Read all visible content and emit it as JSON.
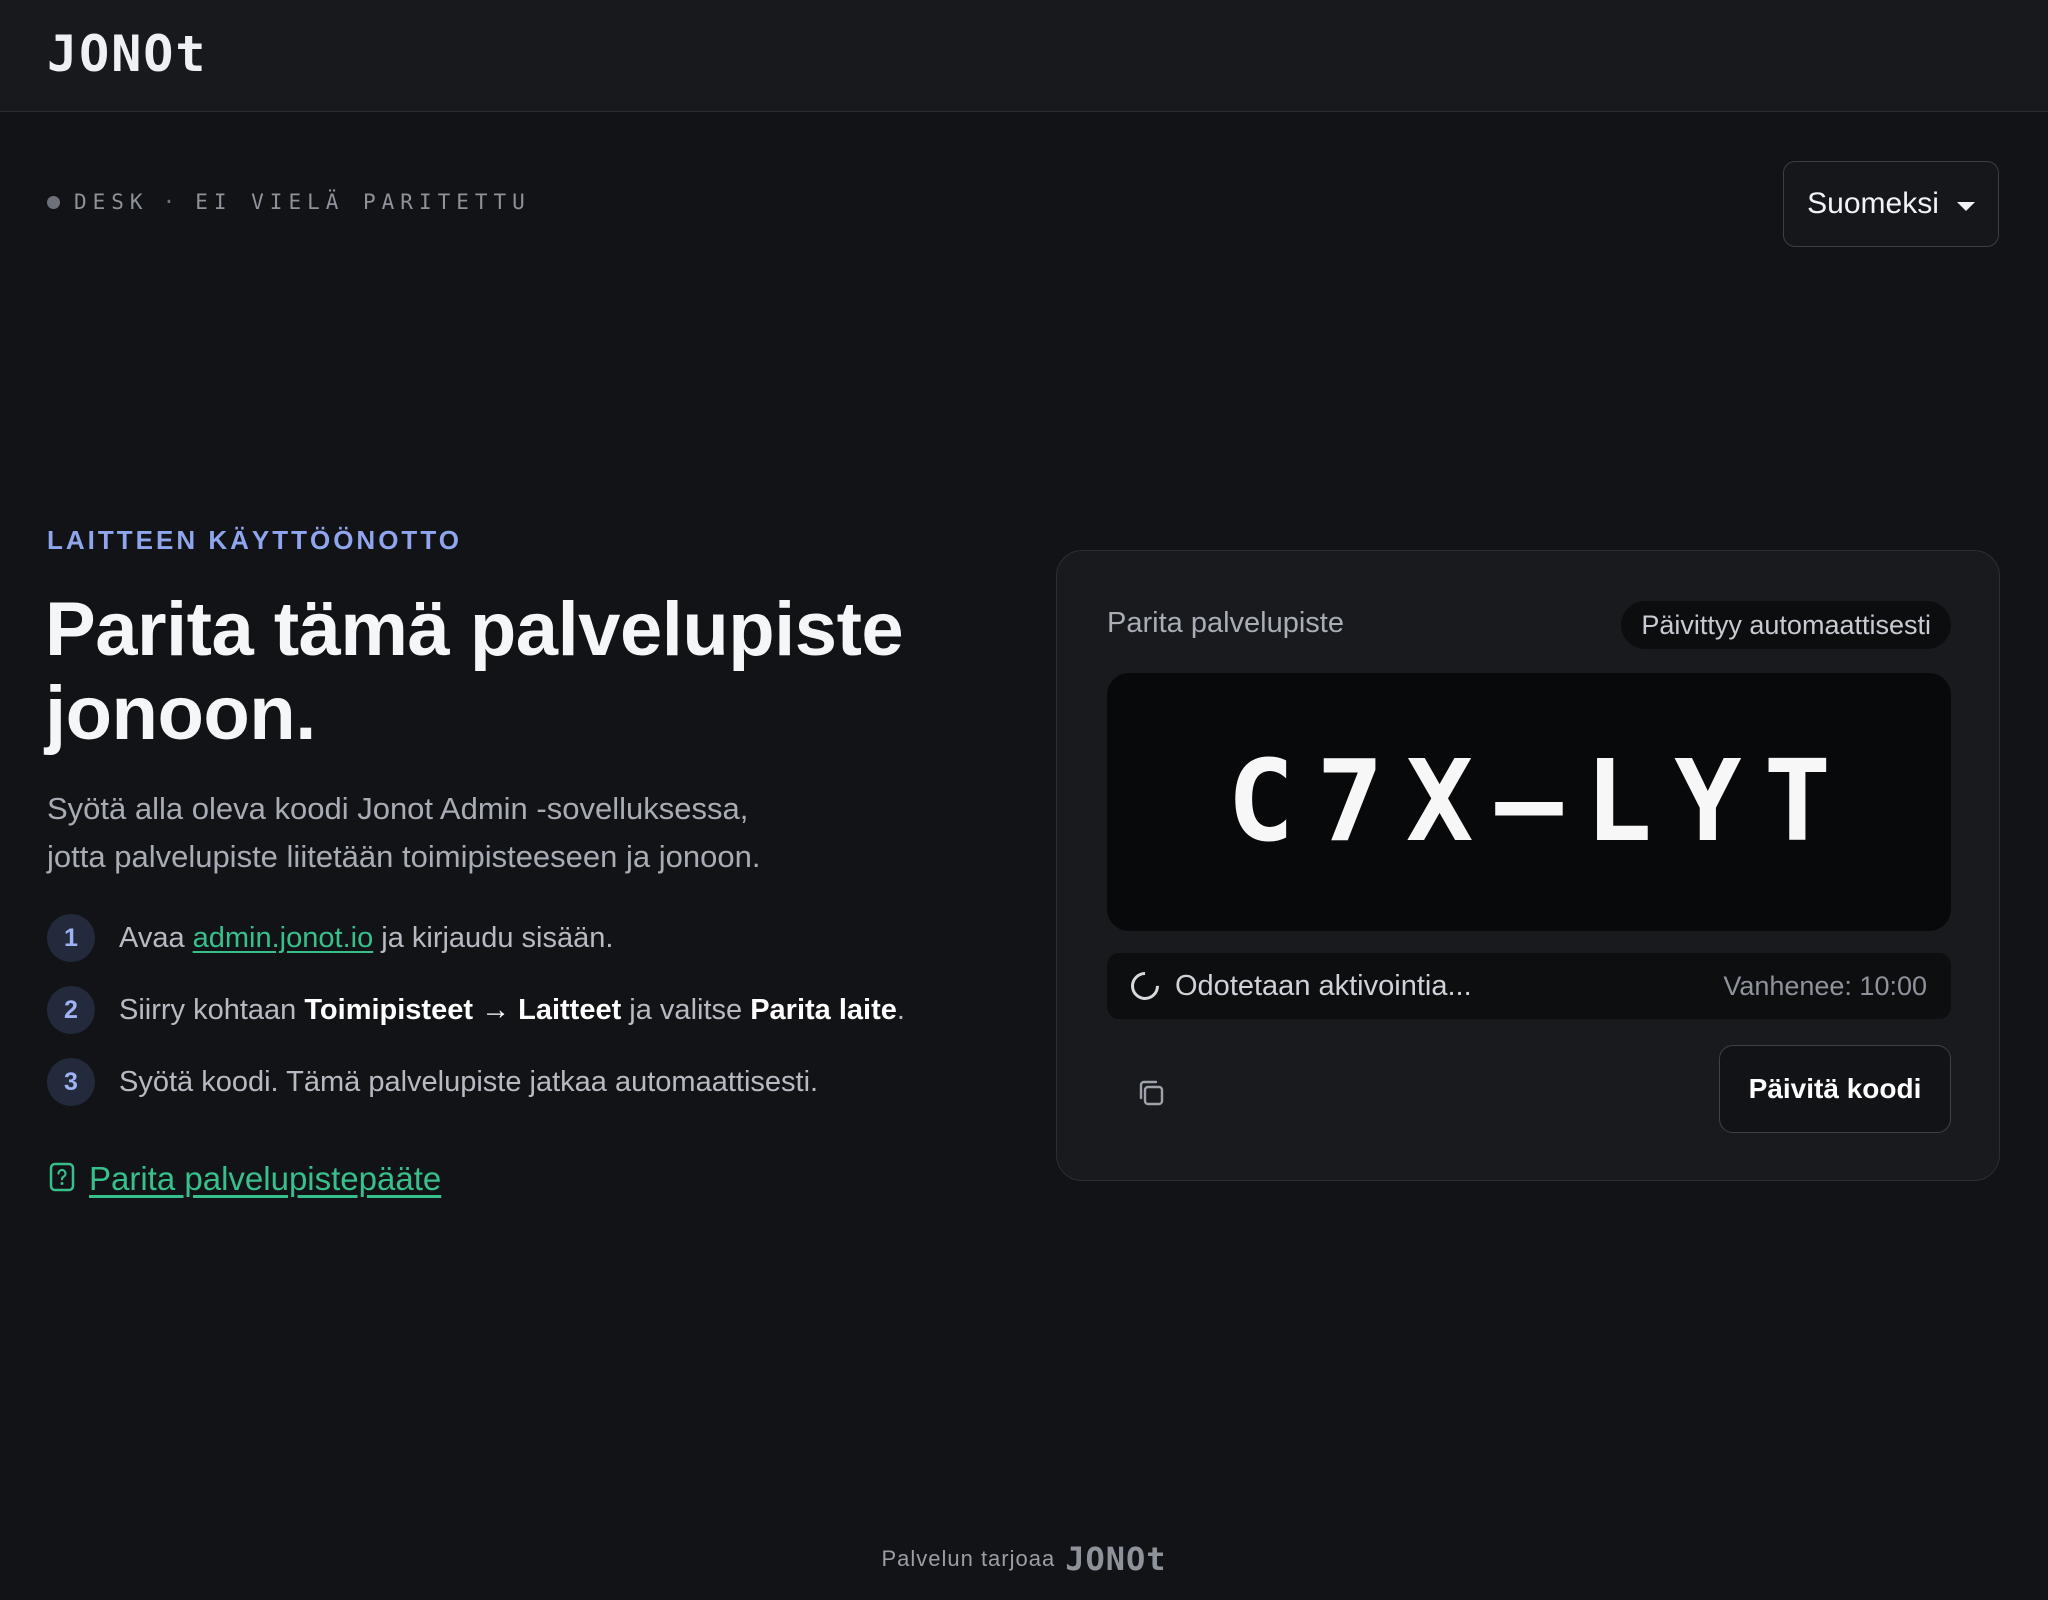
{
  "header": {
    "logo": "JONOt"
  },
  "device_status": {
    "role": "DESK",
    "separator": "·",
    "state": "EI VIELÄ PARITETTU"
  },
  "language": {
    "selected": "Suomeksi"
  },
  "intro": {
    "eyebrow": "LAITTEEN KÄYTTÖÖNOTTO",
    "headline": "Parita tämä palvelupiste jonoon.",
    "lede_line1": "Syötä alla oleva koodi Jonot Admin -sovelluksessa,",
    "lede_line2": "jotta palvelupiste liitetään toimipisteeseen ja jonoon."
  },
  "steps": [
    {
      "num": "1",
      "pre": "Avaa ",
      "link": "admin.jonot.io",
      "post": " ja kirjaudu sisään."
    },
    {
      "num": "2",
      "pre": "Siirry kohtaan ",
      "b1": "Toimipisteet → Laitteet",
      "mid": " ja valitse ",
      "b2": "Parita laite",
      "post": "."
    },
    {
      "num": "3",
      "text": "Syötä koodi. Tämä palvelupiste jatkaa automaattisesti."
    }
  ],
  "pair_terminal_link": "Parita palvelupistepääte",
  "card": {
    "title": "Parita palvelupiste",
    "badge": "Päivittyy automaattisesti",
    "code": "C7X–LYT",
    "status": "Odotetaan aktivointia...",
    "expires": "Vanhenee: 10:00",
    "refresh_label": "Päivitä koodi"
  },
  "footer": {
    "text": "Palvelun tarjoaa",
    "logo": "JONOt"
  },
  "colors": {
    "accent_green": "#37c08c",
    "accent_blue": "#8fa6ee",
    "background": "#111316"
  }
}
